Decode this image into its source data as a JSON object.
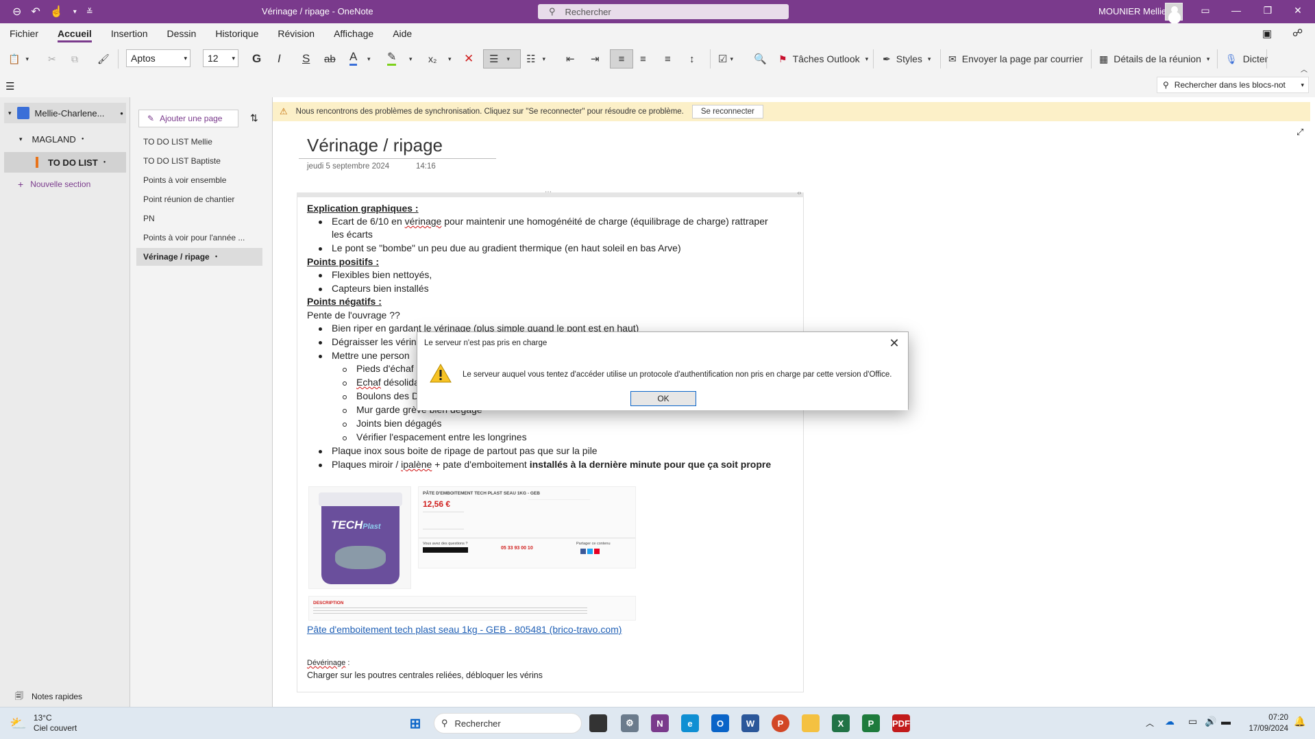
{
  "window": {
    "title": "Vérinage / ripage  -  OneNote",
    "search_placeholder": "Rechercher",
    "user_name": "MOUNIER Mellie"
  },
  "menu": {
    "tabs": [
      "Fichier",
      "Accueil",
      "Insertion",
      "Dessin",
      "Historique",
      "Révision",
      "Affichage",
      "Aide"
    ],
    "active": "Accueil"
  },
  "ribbon": {
    "font_name": "Aptos",
    "font_size": "12",
    "bold": "G",
    "italic": "I",
    "underline": "S",
    "strike": "ab",
    "outlook_tasks": "Tâches Outlook",
    "styles": "Styles",
    "email_page": "Envoyer la page par courrier",
    "meeting_details": "Détails de la réunion",
    "dictate": "Dicter"
  },
  "search_notebooks_placeholder": "Rechercher dans les blocs-not",
  "notebook": {
    "name": "Mellie-Charlene...",
    "section_group": "MAGLAND",
    "section": "TO DO LIST",
    "new_section": "Nouvelle section",
    "section_color": "#e8731a"
  },
  "pages": {
    "add_page": "Ajouter une page",
    "items": [
      "TO DO LIST Mellie",
      "TO DO LIST Baptiste",
      "Points à voir ensemble",
      "Point réunion de chantier",
      "PN",
      "Points à voir pour l'année ...",
      "Vérinage / ripage"
    ]
  },
  "sync_bar": {
    "message": "Nous rencontrons des problèmes de synchronisation. Cliquez sur \"Se reconnecter\" pour résoudre ce problème.",
    "button": "Se reconnecter"
  },
  "page": {
    "title": "Vérinage / ripage",
    "date": "jeudi 5 septembre 2024",
    "time": "14:16",
    "h1": "Explication graphiques :",
    "b1a": "Ecart de 6/10 en ",
    "b1b": "vérinage",
    "b1c": " pour maintenir une homogénéité de charge (équilibrage de charge) rattraper",
    "b1d": "les écarts",
    "b2": "Le pont se \"bombe\" un peu due au gradient thermique (en haut soleil en bas Arve)",
    "h2": "Points positifs :",
    "p1": "Flexibles bien nettoyés,",
    "p2": "Capteurs bien installés",
    "h3": "Points négatifs :",
    "neg_intro": "Pente de l'ouvrage ??",
    "n1": "Bien riper en gardant le vérinage (plus simple quand le pont est en haut)",
    "n2": "Dégraisser les vérin",
    "n3": "Mettre une person",
    "s1": "Pieds d'échaf",
    "s2a": "Echaf",
    "s2b": " désolida",
    "s3": "Boulons des D",
    "s4": "Mur garde grève bien dégagé",
    "s5": "Joints bien dégagés",
    "s6": "Vérifier l'espacement entre les longrines",
    "n4": "Plaque inox sous boite de ripage de partout pas que sur la pile",
    "n5a": "Plaques miroir / ",
    "n5b": "ipalène",
    "n5c": " + pate d'emboitement  ",
    "n5d": "installés à la dernière minute pour que ça soit propre",
    "link": "Pâte d'emboitement tech plast seau 1kg - GEB - 805481 (brico-travo.com)",
    "dev_label": "Dévérinage",
    "dev_label_suffix": " :",
    "dev_text": "Charger sur les poutres centrales reliées, débloquer les vérins"
  },
  "product": {
    "brand": "TECH",
    "brand2": "Plast",
    "heading": "PÂTE D'EMBOITEMENT TECH PLAST SEAU 1KG - GEB",
    "price": "12,56 €",
    "phone": "05 33 93 00 10",
    "desc_title": "DESCRIPTION",
    "share": "Partager ce contenu",
    "questions": "Vous avez des questions ?"
  },
  "dialog": {
    "title": "Le serveur n'est pas pris en charge",
    "message": "Le serveur auquel vous tentez d'accéder utilise un protocole d'authentification non pris en charge par cette version d'Office.",
    "ok": "OK"
  },
  "quick_notes": "Notes rapides",
  "taskbar": {
    "temp": "13°C",
    "weather": "Ciel couvert",
    "search": "Rechercher",
    "time": "07:20",
    "date": "17/09/2024"
  }
}
